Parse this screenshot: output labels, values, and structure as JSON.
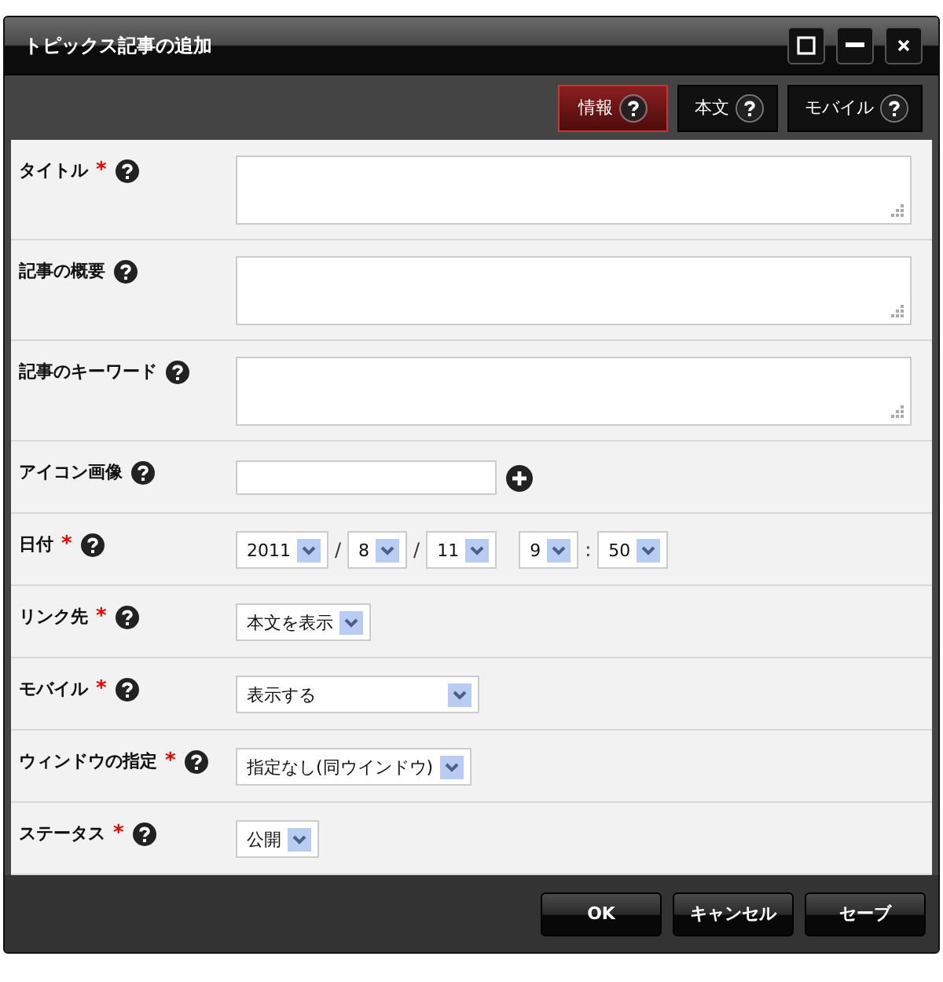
{
  "window": {
    "title": "トピックス記事の追加"
  },
  "tabs": [
    {
      "label": "情報",
      "selected": true
    },
    {
      "label": "本文",
      "selected": false
    },
    {
      "label": "モバイル",
      "selected": false
    }
  ],
  "required_mark": "*",
  "fields": [
    {
      "label": "タイトル",
      "required": true,
      "kind": "textarea"
    },
    {
      "label": "記事の概要",
      "required": false,
      "kind": "textarea"
    },
    {
      "label": "記事のキーワード",
      "required": false,
      "kind": "textarea"
    },
    {
      "label": "アイコン画像",
      "required": false,
      "kind": "file"
    },
    {
      "label": "日付",
      "required": true,
      "kind": "date",
      "parts": [
        {
          "kind": "select",
          "value": "2011"
        },
        {
          "kind": "separator",
          "text": "/"
        },
        {
          "kind": "select",
          "value": "8"
        },
        {
          "kind": "separator",
          "text": "/"
        },
        {
          "kind": "select",
          "value": "11"
        },
        {
          "kind": "spacer"
        },
        {
          "kind": "select",
          "value": "9"
        },
        {
          "kind": "separator",
          "text": ":"
        },
        {
          "kind": "select",
          "value": "50"
        }
      ]
    },
    {
      "label": "リンク先",
      "required": true,
      "kind": "select",
      "value": "本文を表示"
    },
    {
      "label": "モバイル",
      "required": true,
      "kind": "select",
      "value": "表示する",
      "wide": true
    },
    {
      "label": "ウィンドウの指定",
      "required": true,
      "kind": "select",
      "value": "指定なし(同ウインドウ)"
    },
    {
      "label": "ステータス",
      "required": true,
      "kind": "select",
      "value": "公開"
    }
  ],
  "buttons": [
    "OK",
    "キャンセル",
    "セーブ"
  ]
}
